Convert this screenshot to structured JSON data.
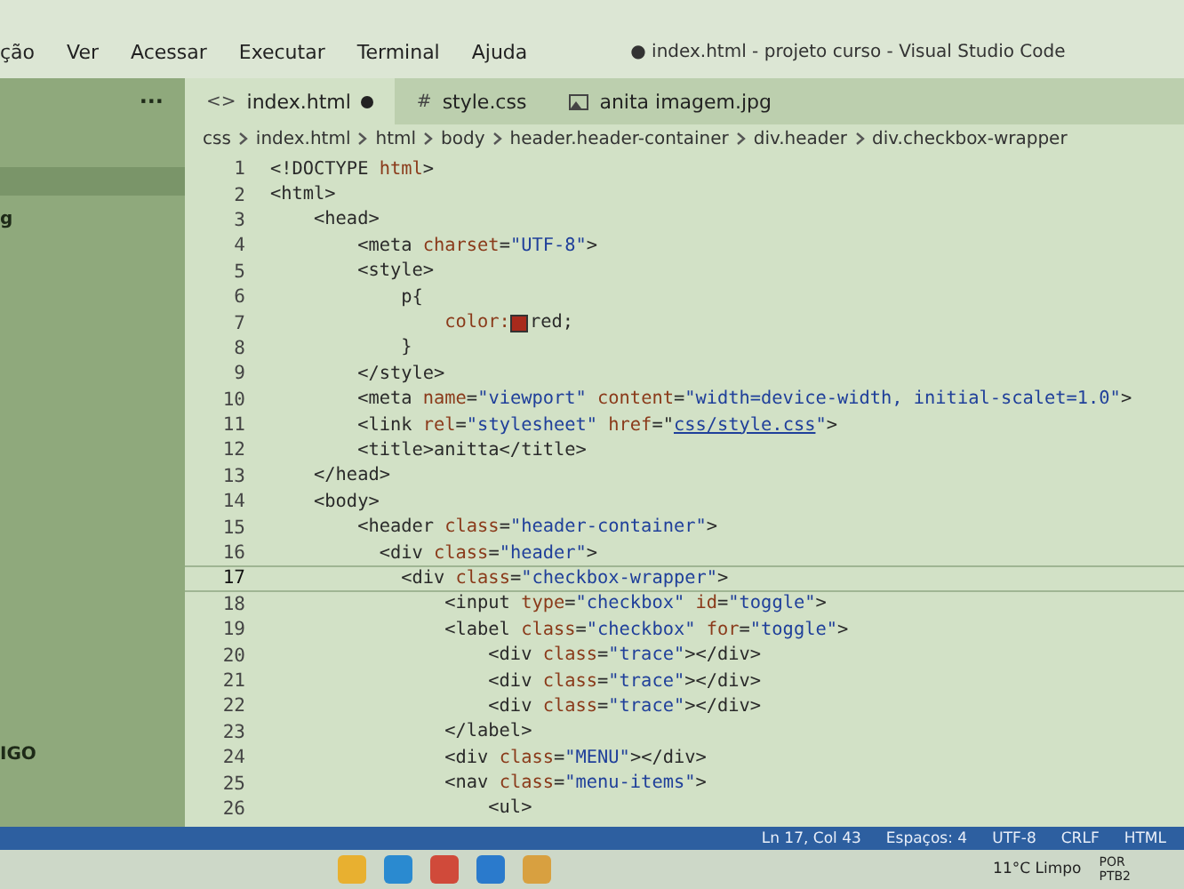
{
  "menu_bar": {
    "items": [
      "ção",
      "Ver",
      "Acessar",
      "Executar",
      "Terminal",
      "Ajuda"
    ],
    "title": "● index.html - projeto curso - Visual Studio Code"
  },
  "sidebar": {
    "more": "···",
    "items": [
      "g",
      "IGO"
    ]
  },
  "tabs": [
    {
      "label": "index.html",
      "kind": "text",
      "icon": "<>",
      "selected": true,
      "modified": true
    },
    {
      "label": "style.css",
      "kind": "text",
      "icon": "#",
      "selected": false,
      "modified": false
    },
    {
      "label": "anita imagem.jpg",
      "kind": "image",
      "selected": false,
      "modified": false
    }
  ],
  "breadcrumbs": [
    "css",
    "index.html",
    "html",
    "body",
    "header.header-container",
    "div.header",
    "div.checkbox-wrapper"
  ],
  "code_lines": [
    {
      "number": "1",
      "current": false,
      "tokens": [
        {
          "kind": "tag",
          "text": "<!DOCTYPE "
        },
        {
          "kind": "attr",
          "text": "html"
        },
        {
          "kind": "tag",
          "text": ">"
        }
      ]
    },
    {
      "number": "2",
      "current": false,
      "tokens": [
        {
          "kind": "tag",
          "text": "<html>"
        }
      ]
    },
    {
      "number": "3",
      "current": false,
      "tokens": [
        {
          "kind": "tag",
          "text": "    <head>"
        }
      ]
    },
    {
      "number": "4",
      "current": false,
      "tokens": [
        {
          "kind": "tag",
          "text": "        <meta "
        },
        {
          "kind": "attr",
          "text": "charset"
        },
        {
          "kind": "tag",
          "text": "="
        },
        {
          "kind": "str",
          "text": "\"UTF-8\""
        },
        {
          "kind": "tag",
          "text": ">"
        }
      ]
    },
    {
      "number": "5",
      "current": false,
      "tokens": [
        {
          "kind": "tag",
          "text": "        <style>"
        }
      ]
    },
    {
      "number": "6",
      "current": false,
      "tokens": [
        {
          "kind": "tag",
          "text": "            p{"
        }
      ]
    },
    {
      "number": "7",
      "current": false,
      "tokens": [
        {
          "kind": "attr",
          "text": "                color:"
        },
        {
          "kind": "swatch",
          "color": "#a82a1c"
        },
        {
          "kind": "tag",
          "text": "red;"
        }
      ]
    },
    {
      "number": "8",
      "current": false,
      "tokens": [
        {
          "kind": "tag",
          "text": "            }"
        }
      ]
    },
    {
      "number": "9",
      "current": false,
      "tokens": [
        {
          "kind": "tag",
          "text": "        </style>"
        }
      ]
    },
    {
      "number": "10",
      "current": false,
      "tokens": [
        {
          "kind": "tag",
          "text": "        <meta "
        },
        {
          "kind": "attr",
          "text": "name"
        },
        {
          "kind": "tag",
          "text": "="
        },
        {
          "kind": "str",
          "text": "\"viewport\" "
        },
        {
          "kind": "attr",
          "text": "content"
        },
        {
          "kind": "tag",
          "text": "="
        },
        {
          "kind": "str",
          "text": "\"width=device-width, initial-scalet=1.0\""
        },
        {
          "kind": "tag",
          "text": ">"
        }
      ]
    },
    {
      "number": "11",
      "current": false,
      "tokens": [
        {
          "kind": "tag",
          "text": "        <link "
        },
        {
          "kind": "attr",
          "text": "rel"
        },
        {
          "kind": "tag",
          "text": "="
        },
        {
          "kind": "str",
          "text": "\"stylesheet\" "
        },
        {
          "kind": "attr",
          "text": "href"
        },
        {
          "kind": "tag",
          "text": "=\""
        },
        {
          "kind": "link",
          "text": "css/style.css"
        },
        {
          "kind": "str",
          "text": "\""
        },
        {
          "kind": "tag",
          "text": ">"
        }
      ]
    },
    {
      "number": "12",
      "current": false,
      "tokens": [
        {
          "kind": "tag",
          "text": "        <title>anitta</title>"
        }
      ]
    },
    {
      "number": "13",
      "current": false,
      "tokens": [
        {
          "kind": "tag",
          "text": "    </head>"
        }
      ]
    },
    {
      "number": "14",
      "current": false,
      "tokens": [
        {
          "kind": "tag",
          "text": "    <body>"
        }
      ]
    },
    {
      "number": "15",
      "current": false,
      "tokens": [
        {
          "kind": "tag",
          "text": "        <header "
        },
        {
          "kind": "attr",
          "text": "class"
        },
        {
          "kind": "tag",
          "text": "="
        },
        {
          "kind": "str",
          "text": "\"header-container\""
        },
        {
          "kind": "tag",
          "text": ">"
        }
      ]
    },
    {
      "number": "16",
      "current": false,
      "tokens": [
        {
          "kind": "tag",
          "text": "          <div "
        },
        {
          "kind": "attr",
          "text": "class"
        },
        {
          "kind": "tag",
          "text": "="
        },
        {
          "kind": "str",
          "text": "\"header\""
        },
        {
          "kind": "tag",
          "text": ">"
        }
      ]
    },
    {
      "number": "17",
      "current": true,
      "tokens": [
        {
          "kind": "tag",
          "text": "            <div "
        },
        {
          "kind": "attr",
          "text": "class"
        },
        {
          "kind": "tag",
          "text": "="
        },
        {
          "kind": "str",
          "text": "\"checkbox-wrapper\""
        },
        {
          "kind": "tag",
          "text": ">"
        }
      ]
    },
    {
      "number": "18",
      "current": false,
      "tokens": [
        {
          "kind": "tag",
          "text": "                <input "
        },
        {
          "kind": "attr",
          "text": "type"
        },
        {
          "kind": "tag",
          "text": "="
        },
        {
          "kind": "str",
          "text": "\"checkbox\" "
        },
        {
          "kind": "attr",
          "text": "id"
        },
        {
          "kind": "tag",
          "text": "="
        },
        {
          "kind": "str",
          "text": "\"toggle\""
        },
        {
          "kind": "tag",
          "text": ">"
        }
      ]
    },
    {
      "number": "19",
      "current": false,
      "tokens": [
        {
          "kind": "tag",
          "text": "                <label "
        },
        {
          "kind": "attr",
          "text": "class"
        },
        {
          "kind": "tag",
          "text": "="
        },
        {
          "kind": "str",
          "text": "\"checkbox\" "
        },
        {
          "kind": "attr",
          "text": "for"
        },
        {
          "kind": "tag",
          "text": "="
        },
        {
          "kind": "str",
          "text": "\"toggle\""
        },
        {
          "kind": "tag",
          "text": ">"
        }
      ]
    },
    {
      "number": "20",
      "current": false,
      "tokens": [
        {
          "kind": "tag",
          "text": "                    <div "
        },
        {
          "kind": "attr",
          "text": "class"
        },
        {
          "kind": "tag",
          "text": "="
        },
        {
          "kind": "str",
          "text": "\"trace\""
        },
        {
          "kind": "tag",
          "text": "></div>"
        }
      ]
    },
    {
      "number": "21",
      "current": false,
      "tokens": [
        {
          "kind": "tag",
          "text": "                    <div "
        },
        {
          "kind": "attr",
          "text": "class"
        },
        {
          "kind": "tag",
          "text": "="
        },
        {
          "kind": "str",
          "text": "\"trace\""
        },
        {
          "kind": "tag",
          "text": "></div>"
        }
      ]
    },
    {
      "number": "22",
      "current": false,
      "tokens": [
        {
          "kind": "tag",
          "text": "                    <div "
        },
        {
          "kind": "attr",
          "text": "class"
        },
        {
          "kind": "tag",
          "text": "="
        },
        {
          "kind": "str",
          "text": "\"trace\""
        },
        {
          "kind": "tag",
          "text": "></div>"
        }
      ]
    },
    {
      "number": "23",
      "current": false,
      "tokens": [
        {
          "kind": "tag",
          "text": "                </label>"
        }
      ]
    },
    {
      "number": "24",
      "current": false,
      "tokens": [
        {
          "kind": "tag",
          "text": "                <div "
        },
        {
          "kind": "attr",
          "text": "class"
        },
        {
          "kind": "tag",
          "text": "="
        },
        {
          "kind": "str",
          "text": "\"MENU\""
        },
        {
          "kind": "tag",
          "text": "></div>"
        }
      ]
    },
    {
      "number": "25",
      "current": false,
      "tokens": [
        {
          "kind": "tag",
          "text": "                <nav "
        },
        {
          "kind": "attr",
          "text": "class"
        },
        {
          "kind": "tag",
          "text": "="
        },
        {
          "kind": "str",
          "text": "\"menu-items\""
        },
        {
          "kind": "tag",
          "text": ">"
        }
      ]
    },
    {
      "number": "26",
      "current": false,
      "tokens": [
        {
          "kind": "tag",
          "text": "                    <ul>"
        }
      ]
    }
  ],
  "status_bar": [
    "Ln 17, Col 43",
    "Espaços: 4",
    "UTF-8",
    "CRLF",
    "HTML"
  ],
  "taskbar": {
    "apps": [
      {
        "kind": "folder"
      },
      {
        "kind": "edge"
      },
      {
        "kind": "chrome"
      },
      {
        "kind": "vscode"
      },
      {
        "kind": "files"
      }
    ],
    "weather": "11°C  Limpo",
    "language": [
      "POR",
      "PTB2"
    ]
  }
}
